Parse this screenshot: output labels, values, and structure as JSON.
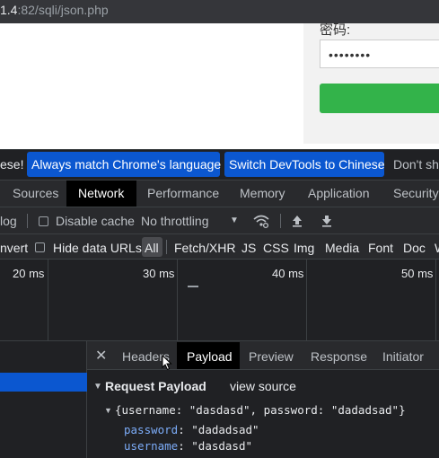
{
  "address_bar": {
    "prefix": "1.4",
    "suffix": ":82/sqli/json.php"
  },
  "login_form": {
    "password_label": "密码:",
    "password_value": "••••••••",
    "submit_color": "#33b34a"
  },
  "language_infobar": {
    "lead_text": "ese!",
    "button_match": "Always match Chrome's language",
    "button_switch": "Switch DevTools to Chinese",
    "trail_text": "Don't sh"
  },
  "devtools_tabs": {
    "sources": "Sources",
    "network": "Network",
    "performance": "Performance",
    "memory": "Memory",
    "application": "Application",
    "security": "Security",
    "active": "Network"
  },
  "network_toolbar": {
    "preserve_log_partial": "log",
    "disable_cache": "Disable cache",
    "throttling": "No throttling"
  },
  "filter_bar": {
    "invert_partial": "nvert",
    "hide_data_urls": "Hide data URLs",
    "types": [
      "All",
      "Fetch/XHR",
      "JS",
      "CSS",
      "Img",
      "Media",
      "Font",
      "Doc",
      "W"
    ],
    "active": "All"
  },
  "timeline": {
    "ticks": [
      "20 ms",
      "30 ms",
      "40 ms",
      "50 ms"
    ]
  },
  "details_tabs": {
    "headers": "Headers",
    "payload": "Payload",
    "preview": "Preview",
    "response": "Response",
    "initiator": "Initiator",
    "active": "Payload"
  },
  "payload": {
    "section_title": "Request Payload",
    "view_source": "view source",
    "summary": "{username: \"dasdasd\", password: \"dadadsad\"}",
    "fields": [
      {
        "key": "password",
        "value": "\"dadadsad\""
      },
      {
        "key": "username",
        "value": "\"dasdasd\""
      }
    ]
  },
  "colors": {
    "accent_blue": "#0b57d0",
    "devtools_bg": "#202124",
    "key_color": "#7cacf8"
  }
}
